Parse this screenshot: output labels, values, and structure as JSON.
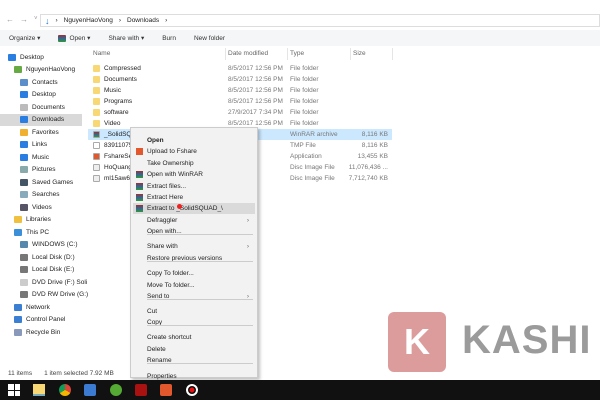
{
  "address": {
    "path": [
      "NguyenHaoVong",
      "Downloads"
    ]
  },
  "toolbar": {
    "organize": "Organize ▾",
    "open": "Open ▾",
    "share": "Share with ▾",
    "burn": "Burn",
    "new_folder": "New folder"
  },
  "sidebar": {
    "items": [
      "Desktop",
      "NguyenHaoVong",
      "Contacts",
      "Desktop",
      "Documents",
      "Downloads",
      "Favorites",
      "Links",
      "Music",
      "Pictures",
      "Saved Games",
      "Searches",
      "Videos",
      "Libraries",
      "This PC",
      "WINDOWS (C:)",
      "Local Disk (D:)",
      "Local Disk (E:)",
      "DVD Drive (F:) Soli",
      "DVD RW Drive (G:)",
      "Network",
      "Control Panel",
      "Recycle Bin"
    ]
  },
  "columns": {
    "name": "Name",
    "date": "Date modified",
    "type": "Type",
    "size": "Size"
  },
  "files": [
    {
      "name": "Compressed",
      "date": "8/5/2017 12:56 PM",
      "type": "File folder",
      "size": ""
    },
    {
      "name": "Documents",
      "date": "8/5/2017 12:56 PM",
      "type": "File folder",
      "size": ""
    },
    {
      "name": "Music",
      "date": "8/5/2017 12:56 PM",
      "type": "File folder",
      "size": ""
    },
    {
      "name": "Programs",
      "date": "8/5/2017 12:56 PM",
      "type": "File folder",
      "size": ""
    },
    {
      "name": "software",
      "date": "27/9/2017 7:34 PM",
      "type": "File folder",
      "size": ""
    },
    {
      "name": "Video",
      "date": "8/5/2017 12:56 PM",
      "type": "File folder",
      "size": ""
    },
    {
      "name": "_SolidSQ",
      "date": "7 7:11 AM",
      "type": "WinRAR archive",
      "size": "8,116 KB"
    },
    {
      "name": "83911075",
      "date": "11:54 PM",
      "type": "TMP File",
      "size": "8,116 KB"
    },
    {
      "name": "FshareSet",
      "date": "7 9:18 PM",
      "type": "Application",
      "size": "13,455 KB"
    },
    {
      "name": "HoQuang",
      "date": "7 6:55 AM",
      "type": "Disc Image File",
      "size": "11,076,436 ..."
    },
    {
      "name": "ml15aw6",
      "date": "7 10:40 ...",
      "type": "Disc Image File",
      "size": "7,712,740 KB"
    }
  ],
  "context_menu": [
    "Open",
    "Upload to Fshare",
    "Take Ownership",
    "Open with WinRAR",
    "Extract files...",
    "Extract Here",
    "Extract to _SolidSQUAD_\\",
    "Defraggler",
    "Open with...",
    "Share with",
    "Restore previous versions",
    "Copy To folder...",
    "Move To folder...",
    "Send to",
    "Cut",
    "Copy",
    "Create shortcut",
    "Delete",
    "Rename",
    "Properties"
  ],
  "status": {
    "count": "11 items",
    "selected": "1 item selected  7.92 MB"
  },
  "watermark": {
    "letter": "K",
    "text": "KASHI"
  }
}
